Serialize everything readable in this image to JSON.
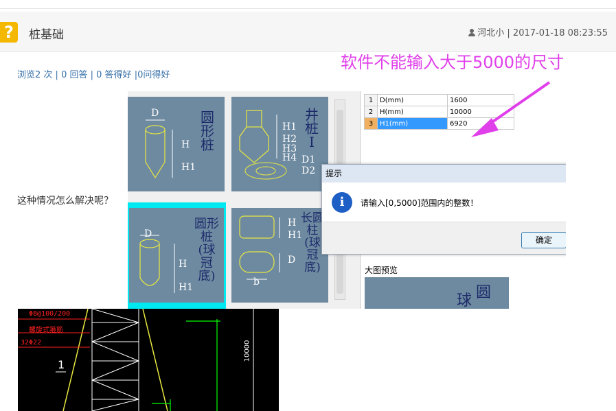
{
  "header": {
    "title": "桩基础",
    "user": "河北小",
    "timestamp": "2017-01-18 08:23:55",
    "icon": "question-icon"
  },
  "stats": {
    "views": "浏览2 次",
    "answers": "0 回答",
    "good_answers": "0 答得好",
    "good_questions": "0问得好",
    "sep": "|"
  },
  "annotation": "软件不能输入大于5000的尺寸",
  "question": "这种情况怎么解决呢？",
  "software": {
    "tiles": [
      {
        "name": "圆形桩",
        "dims": [
          "D",
          "H",
          "H1"
        ]
      },
      {
        "name": "井桩I",
        "dims": [
          "H1",
          "H2",
          "H3",
          "H4",
          "D1",
          "D2"
        ]
      },
      {
        "name": "圆形桩(球冠底)",
        "dims": [
          "D",
          "H",
          "H1"
        ]
      },
      {
        "name": "长圆柱(球冠底)",
        "dims": [
          "H",
          "H1",
          "D",
          "b"
        ]
      }
    ],
    "grid": [
      {
        "row": "1",
        "label": "D(mm)",
        "value": "1600"
      },
      {
        "row": "2",
        "label": "H(mm)",
        "value": "10000"
      },
      {
        "row": "3",
        "label": "H1(mm)",
        "value": "6920"
      }
    ],
    "dialog": {
      "title": "提示",
      "message": "请输入[0,5000]范围内的整数！",
      "ok": "确定"
    },
    "preview_label": "大图预览",
    "preview_text": [
      "球",
      "圆"
    ]
  },
  "cad": {
    "rebar1": "Φ8@100/200",
    "note": "螺旋式箍筋",
    "rebar2": "32Φ22",
    "dim": "10000",
    "section": "1"
  },
  "colors": {
    "annotation": "#e040ea",
    "highlight": "#00e8f0",
    "tile": "#6e8aa0"
  }
}
